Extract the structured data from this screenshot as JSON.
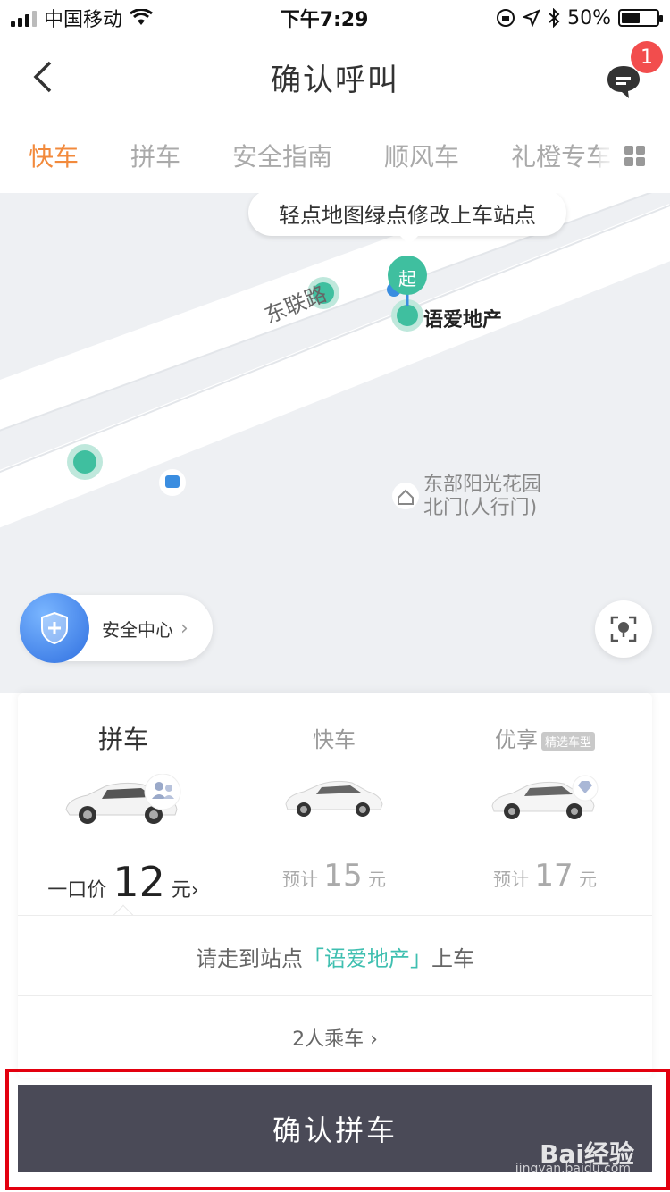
{
  "status_bar": {
    "carrier": "中国移动",
    "time": "下午7:29",
    "battery": "50%"
  },
  "nav": {
    "title": "确认呼叫",
    "message_badge": "1"
  },
  "tabs": [
    "快车",
    "拼车",
    "安全指南",
    "顺风车",
    "礼橙专车"
  ],
  "map": {
    "tooltip": "轻点地图绿点修改上车站点",
    "start_marker": "起",
    "road_name": "东联路",
    "pickup_station": "语爱地产",
    "poi": "东部阳光花园北门(人行门)"
  },
  "safety": {
    "label": "安全中心"
  },
  "ride_options": [
    {
      "name": "拼车",
      "price_prefix": "一口价",
      "price": "12",
      "unit": "元",
      "arrow": "›",
      "selected": true
    },
    {
      "name": "快车",
      "price_prefix": "预计",
      "price": "15",
      "unit": "元",
      "selected": false
    },
    {
      "name": "优享",
      "tag": "精选车型",
      "price_prefix": "预计",
      "price": "17",
      "unit": "元",
      "selected": false
    }
  ],
  "walk_hint": {
    "before": "请走到站点",
    "station": "「语爱地产」",
    "after": "上车"
  },
  "passengers": "2人乘车 ›",
  "confirm_button": "确认拼车",
  "watermark": {
    "brand": "Bai经验",
    "url": "jingyan.baidu.com"
  }
}
